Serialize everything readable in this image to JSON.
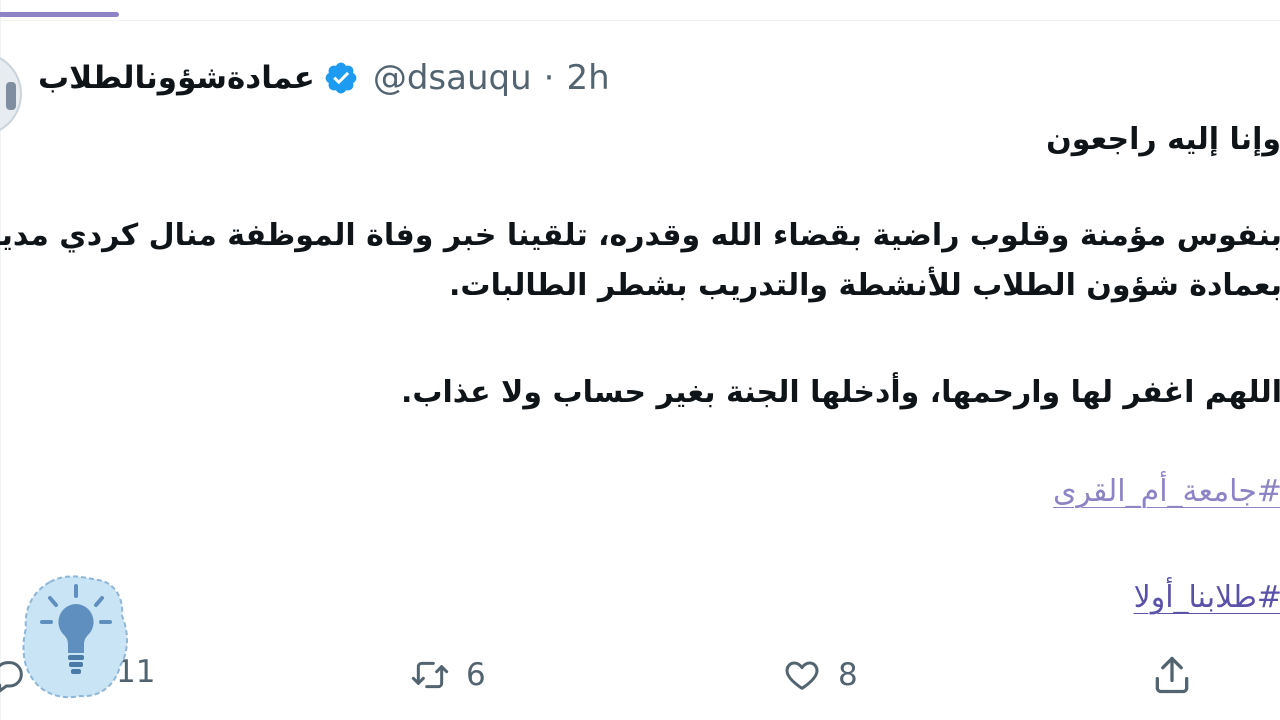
{
  "tweet": {
    "display_name": "عمادةشؤونالطلاب",
    "handle": "@dsauqu",
    "separator": "·",
    "time": "2h",
    "lines": [
      "وإنا إليه راجعون",
      "بنفوس مؤمنة وقلوب راضية بقضاء الله وقدره، تلقينا خبر وفاة الموظفة منال كردي مديرة وحدة التدريب",
      "بعمادة شؤون الطلاب للأنشطة والتدريب بشطر الطالبات.",
      "اللهم اغفر لها وارحمها، وأدخلها الجنة بغير حساب ولا عذاب."
    ],
    "hashtags": [
      "#جامعة_أم_القرى",
      "#طلابنا_أولا"
    ]
  },
  "actions": {
    "reply_count": "11",
    "retweet_count": "6",
    "like_count": "8"
  },
  "icons": {
    "verified": "verified-badge-icon",
    "reply": "reply-icon",
    "retweet": "retweet-icon",
    "like": "heart-icon",
    "share": "share-icon",
    "overlay": "lightbulb-icon"
  },
  "colors": {
    "accent": "#8d84c5",
    "verified": "#1d9bf0",
    "muted": "#536471",
    "text": "#0f1419"
  }
}
